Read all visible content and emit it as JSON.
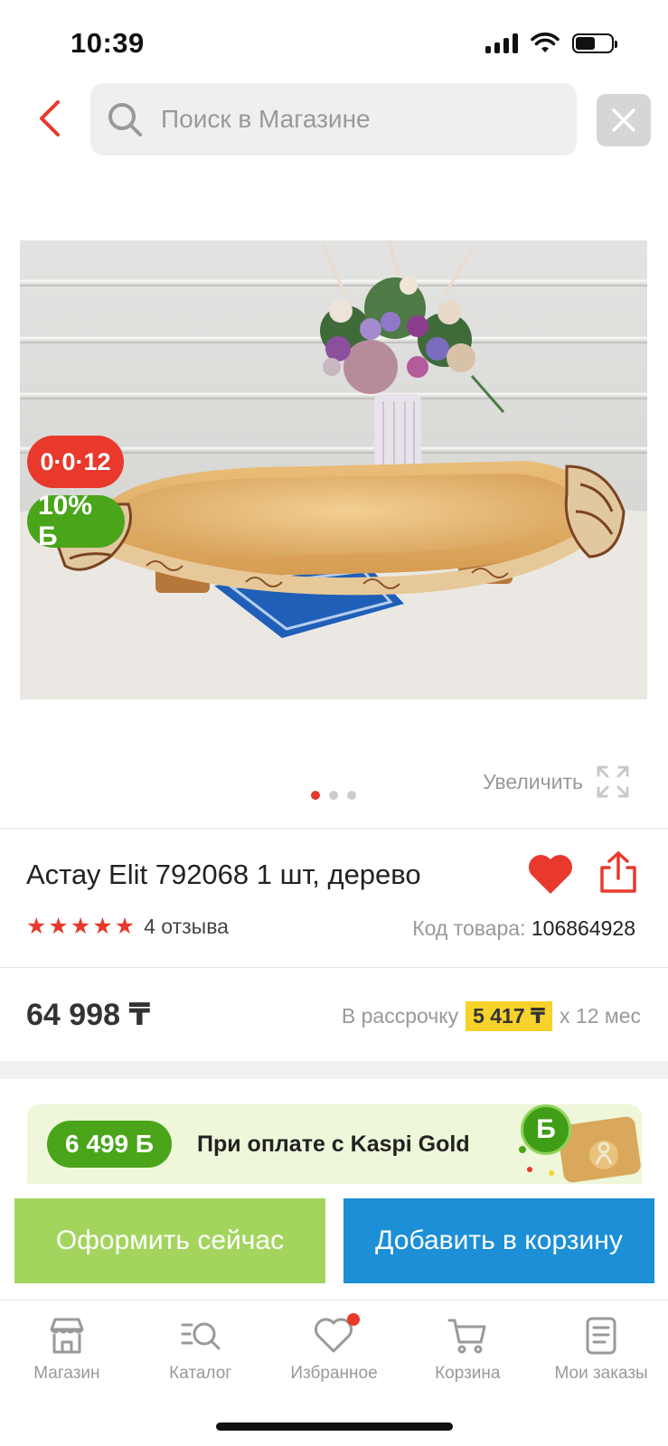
{
  "status_bar": {
    "time": "10:39",
    "battery_level": 0.55
  },
  "search": {
    "placeholder": "Поиск в Магазине"
  },
  "image": {
    "badge_installment": "0·0·12",
    "badge_bonus": "10% Б",
    "zoom_label": "Увеличить",
    "pagination": {
      "total": 3,
      "active": 1
    }
  },
  "product": {
    "title": "Астау Elit 792068 1 шт, дерево",
    "rating": 5,
    "reviews": "4 отзыва",
    "code_label": "Код товара:",
    "code_value": "106864928"
  },
  "pricing": {
    "price": "64 998 ₸",
    "installment_prefix": "В рассрочку",
    "installment_monthly": "5 417 ₸",
    "installment_suffix": "x 12 мес"
  },
  "kaspi_gold": {
    "bonus": "6 499 Б",
    "text": "При оплате с Kaspi Gold",
    "badge_symbol": "Б"
  },
  "actions": {
    "checkout_now": "Оформить сейчас",
    "add_to_cart": "Добавить в корзину"
  },
  "tabs": [
    {
      "label": "Магазин",
      "icon": "store-icon"
    },
    {
      "label": "Каталог",
      "icon": "catalog-search-icon"
    },
    {
      "label": "Избранное",
      "icon": "heart-outline-icon",
      "has_dot": true
    },
    {
      "label": "Корзина",
      "icon": "cart-icon"
    },
    {
      "label": "Мои заказы",
      "icon": "orders-list-icon"
    }
  ],
  "colors": {
    "accent_red": "#e8392c",
    "green": "#4aa51a",
    "light_green": "#a3d55e",
    "blue": "#1c8fd6",
    "yellow": "#f6d22b"
  }
}
